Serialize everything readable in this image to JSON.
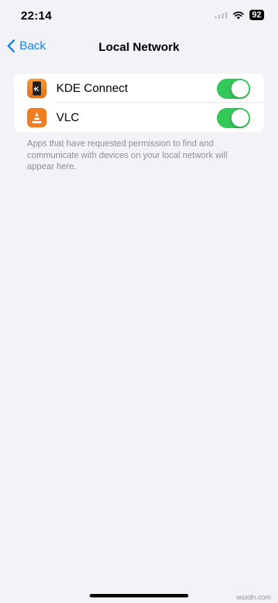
{
  "status_bar": {
    "time": "22:14",
    "battery": "92"
  },
  "nav": {
    "back_label": "Back",
    "title": "Local Network"
  },
  "apps": [
    {
      "name": "KDE Connect",
      "enabled": true,
      "icon": "kde-connect-app-icon"
    },
    {
      "name": "VLC",
      "enabled": true,
      "icon": "vlc-app-icon"
    }
  ],
  "footer_note": "Apps that have requested permission to find and communicate with devices on your local network will appear here.",
  "colors": {
    "accent": "#1a82e2",
    "toggle_on": "#34c759",
    "background": "#f2f2f7",
    "app_icon_orange": "#ef7d22"
  },
  "watermark": "wsxdn.com"
}
